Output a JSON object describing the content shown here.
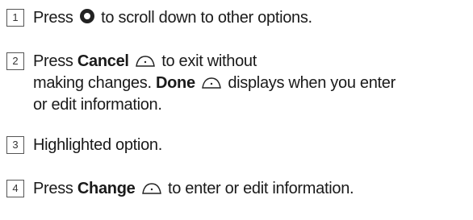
{
  "items": [
    {
      "number": "1",
      "pre": "Press",
      "icon": "nav-key-icon",
      "post": "to scroll down to other options."
    },
    {
      "number": "2",
      "pre": "Press",
      "bold1": "Cancel",
      "icon1": "left-softkey-icon",
      "mid1": "to exit without",
      "mid2": "making changes.",
      "bold2": "Done",
      "icon2": "left-softkey-icon",
      "mid3": "displays when you enter",
      "mid4": "or edit information."
    },
    {
      "number": "3",
      "text": "Highlighted option."
    },
    {
      "number": "4",
      "pre": "Press",
      "bold1": "Change",
      "icon1": "right-softkey-icon",
      "post": "to enter or edit information."
    }
  ]
}
